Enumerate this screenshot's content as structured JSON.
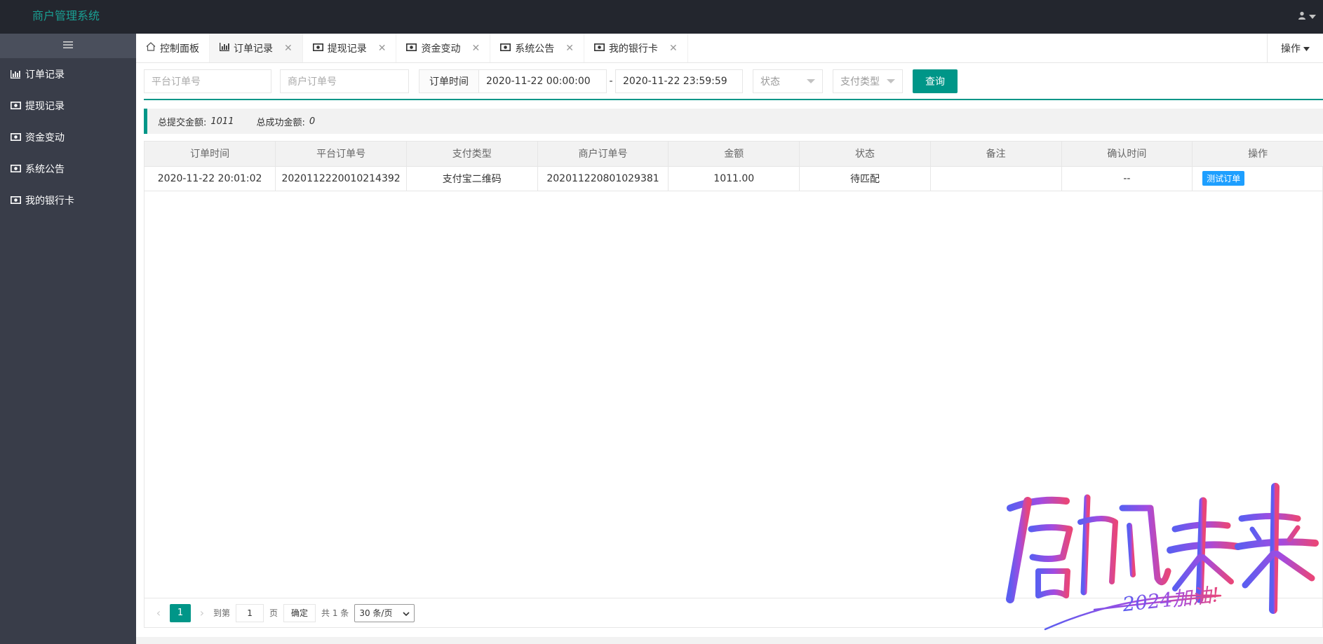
{
  "app": {
    "title": "商户管理系统"
  },
  "header": {
    "user_icon": "user-icon"
  },
  "sidebar": {
    "toggle_icon": "menu-icon",
    "items": [
      {
        "label": "订单记录",
        "icon": "chart-icon"
      },
      {
        "label": "提现记录",
        "icon": "money-icon"
      },
      {
        "label": "资金变动",
        "icon": "money-icon"
      },
      {
        "label": "系统公告",
        "icon": "money-icon"
      },
      {
        "label": "我的银行卡",
        "icon": "money-icon"
      }
    ]
  },
  "tabs": {
    "items": [
      {
        "label": "控制面板",
        "icon": "home-icon",
        "closable": false
      },
      {
        "label": "订单记录",
        "icon": "chart-icon",
        "closable": true,
        "active": true
      },
      {
        "label": "提现记录",
        "icon": "money-icon",
        "closable": true
      },
      {
        "label": "资金变动",
        "icon": "money-icon",
        "closable": true
      },
      {
        "label": "系统公告",
        "icon": "money-icon",
        "closable": true
      },
      {
        "label": "我的银行卡",
        "icon": "money-icon",
        "closable": true
      }
    ],
    "ops_label": "操作"
  },
  "filters": {
    "platform_order_placeholder": "平台订单号",
    "merchant_order_placeholder": "商户订单号",
    "time_label": "订单时间",
    "start_time": "2020-11-22 00:00:00",
    "separator": "-",
    "end_time": "2020-11-22 23:59:59",
    "status_placeholder": "状态",
    "pay_type_placeholder": "支付类型",
    "query_label": "查询"
  },
  "summary": {
    "submitted_label": "总提交金额:",
    "submitted_value": "1011",
    "success_label": "总成功金额:",
    "success_value": "0"
  },
  "table": {
    "columns": [
      "订单时间",
      "平台订单号",
      "支付类型",
      "商户订单号",
      "金额",
      "状态",
      "备注",
      "确认时间",
      "操作"
    ],
    "rows": [
      {
        "time": "2020-11-22 20:01:02",
        "platform_no": "2020112220010214392",
        "pay_type": "支付宝二维码",
        "merchant_no": "202011220801029381",
        "amount": "1011.00",
        "status": "待匹配",
        "remark": "",
        "confirm_time": "--",
        "action": "测试订单"
      }
    ]
  },
  "pager": {
    "current_page": "1",
    "goto_label": "到第",
    "goto_value": "1",
    "page_suffix": "页",
    "confirm_label": "确定",
    "total_label": "共 1 条",
    "page_size": "30 条/页"
  },
  "watermark": {
    "main": "启航未来",
    "sub": "2024加油!"
  },
  "colors": {
    "accent": "#009688",
    "header_bg": "#23262e",
    "sidebar_bg": "#393d49",
    "tag_blue": "#1e9fff"
  }
}
